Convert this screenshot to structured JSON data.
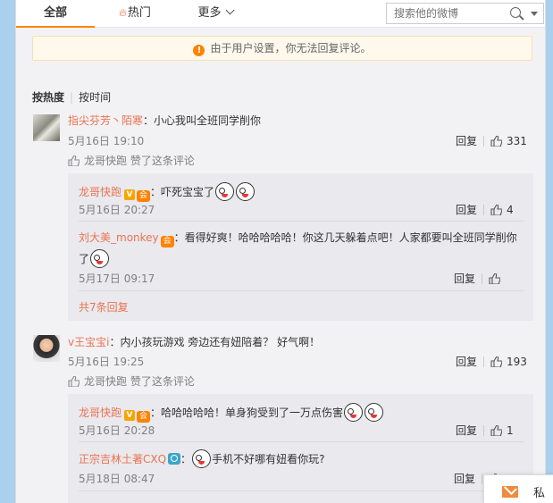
{
  "tabs": {
    "all": "全部",
    "hot": "热门",
    "more": "更多"
  },
  "search": {
    "placeholder": "搜索他的微博"
  },
  "notice": {
    "text": "由于用户设置，你无法回复评论。"
  },
  "sort": {
    "by_hot": "按热度",
    "by_time": "按时间"
  },
  "reply_label": "回复",
  "liked_suffix": "赞了这条评论",
  "comments": [
    {
      "user": "指尖芬芳丶陌寒",
      "text": "：小心我叫全班同学削你",
      "time": "5月16日 19:10",
      "likes": "331",
      "liked_by": "龙哥快跑",
      "replies": [
        {
          "user": "龙哥快跑",
          "text": "：吓死宝宝了",
          "time": "5月16日 20:27",
          "likes": "4"
        },
        {
          "user": "刘大美_monkey",
          "text": "：看得好爽！哈哈哈哈哈！你这几天躲着点吧！人家都要叫全班同学削你",
          "text2": "了",
          "time": "5月17日 09:17",
          "likes": ""
        }
      ],
      "more_replies": "共7条回复"
    },
    {
      "user": "v王宝宝i",
      "text": "：内小孩玩游戏 旁边还有妞陪着？ 好气啊！",
      "time": "5月16日 19:25",
      "likes": "193",
      "liked_by": "龙哥快跑",
      "replies": [
        {
          "user": "龙哥快跑",
          "text": "：哈哈哈哈哈！单身狗受到了一万点伤害",
          "time": "5月16日 20:28",
          "likes": "1"
        },
        {
          "user": "正宗吉林土著CXQ",
          "text": "手机不好哪有妞看你玩?",
          "time": "5月18日 08:47",
          "likes": ""
        }
      ]
    }
  ],
  "messages": {
    "label": "私信"
  },
  "icons": {
    "hot": "flame-icon",
    "more": "chevron-down-icon",
    "search": "search-icon",
    "warning": "warning-icon",
    "like": "thumbs-up-icon",
    "message": "envelope-icon"
  }
}
